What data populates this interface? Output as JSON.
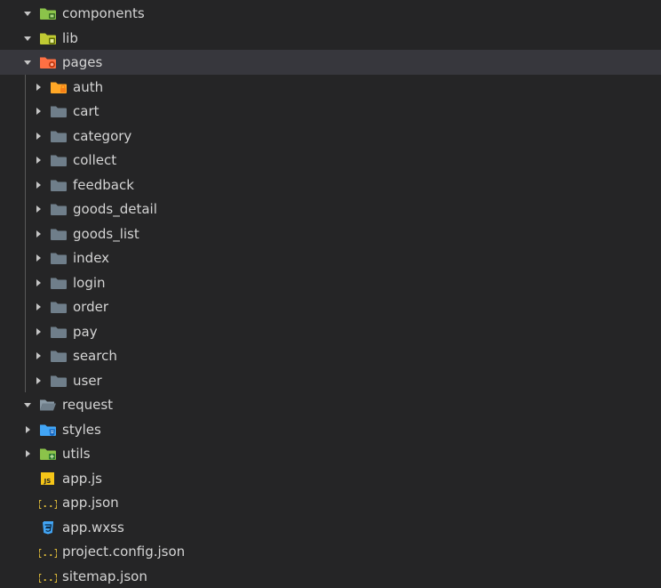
{
  "colors": {
    "background": "#252526",
    "selected_row": "#37373d",
    "text": "#d4d4d4",
    "folder_gray": "#6f7e8a",
    "folder_green": "#8bc34a",
    "folder_lime": "#c0ca33",
    "folder_orange": "#ff7043",
    "folder_blue": "#42a5f5",
    "json_yellow": "#e8c33a",
    "js_yellow": "#f5c518",
    "css_blue": "#42a5f5"
  },
  "tree": {
    "components": {
      "label": "components",
      "icon": "components-folder-icon",
      "expanded": true
    },
    "lib": {
      "label": "lib",
      "icon": "lib-folder-icon",
      "expanded": true
    },
    "pages": {
      "label": "pages",
      "icon": "pages-folder-icon",
      "expanded": true,
      "selected": true,
      "children": [
        {
          "label": "auth",
          "icon": "auth-folder-icon"
        },
        {
          "label": "cart",
          "icon": "folder-icon"
        },
        {
          "label": "category",
          "icon": "folder-icon"
        },
        {
          "label": "collect",
          "icon": "folder-icon"
        },
        {
          "label": "feedback",
          "icon": "folder-icon"
        },
        {
          "label": "goods_detail",
          "icon": "folder-icon"
        },
        {
          "label": "goods_list",
          "icon": "folder-icon"
        },
        {
          "label": "index",
          "icon": "folder-icon"
        },
        {
          "label": "login",
          "icon": "folder-icon"
        },
        {
          "label": "order",
          "icon": "folder-icon"
        },
        {
          "label": "pay",
          "icon": "folder-icon"
        },
        {
          "label": "search",
          "icon": "folder-icon"
        },
        {
          "label": "user",
          "icon": "folder-icon"
        }
      ]
    },
    "request": {
      "label": "request",
      "icon": "open-folder-icon",
      "expanded": true
    },
    "styles": {
      "label": "styles",
      "icon": "styles-folder-icon",
      "expanded": false
    },
    "utils": {
      "label": "utils",
      "icon": "utils-folder-icon",
      "expanded": false
    },
    "files": [
      {
        "label": "app.js",
        "icon": "js-file-icon"
      },
      {
        "label": "app.json",
        "icon": "json-file-icon"
      },
      {
        "label": "app.wxss",
        "icon": "css-file-icon"
      },
      {
        "label": "project.config.json",
        "icon": "json-file-icon"
      },
      {
        "label": "sitemap.json",
        "icon": "json-file-icon"
      }
    ]
  }
}
